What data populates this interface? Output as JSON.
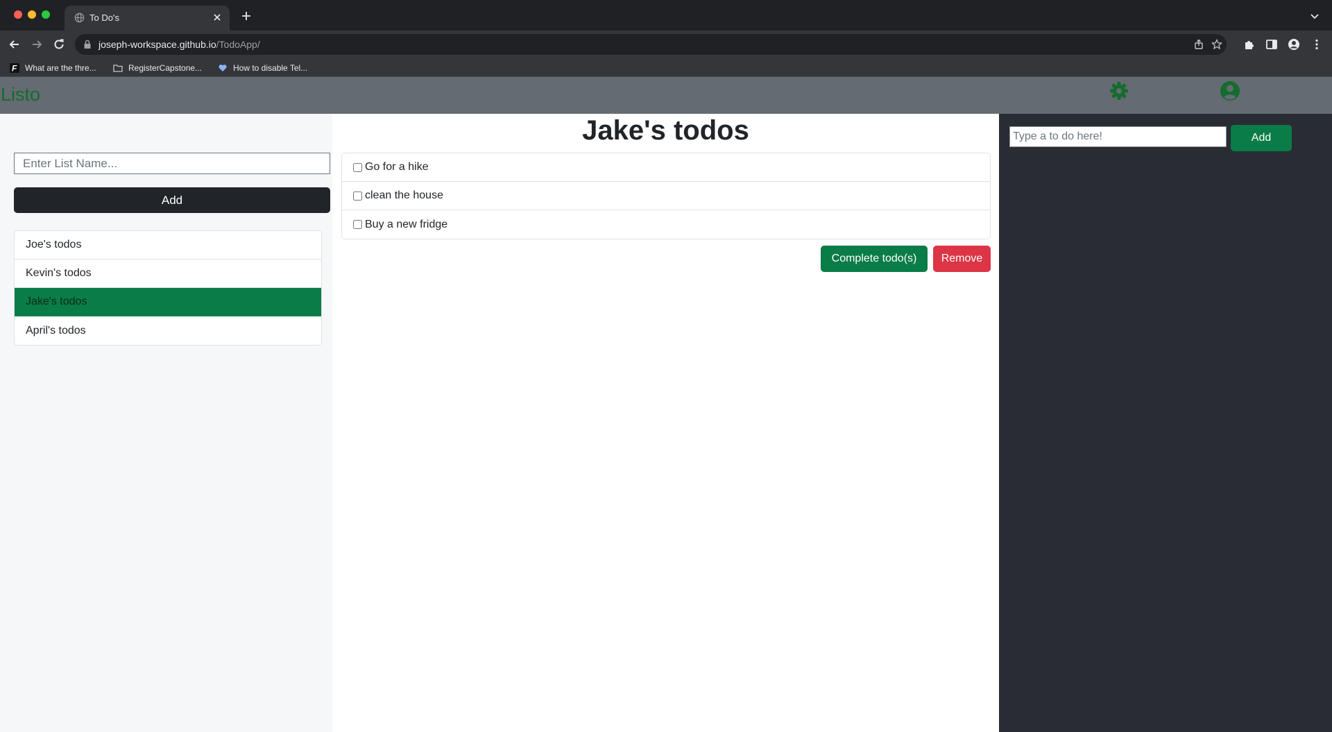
{
  "browser": {
    "tab_title": "To Do's",
    "url_host": "joseph-workspace.github.io",
    "url_path": "/TodoApp/",
    "bookmarks": [
      {
        "label": "What are the thre...",
        "icon": "f-icon"
      },
      {
        "label": "RegisterCapstone...",
        "icon": "folder-icon"
      },
      {
        "label": "How to disable Tel...",
        "icon": "heart-icon"
      }
    ]
  },
  "navbar": {
    "brand": "Listo",
    "brand_color": "#146c2e",
    "settings_icon": "gear-icon",
    "profile_icon": "user-circle-icon"
  },
  "lists_panel": {
    "input_placeholder": "Enter List Name...",
    "add_label": "Add",
    "lists": [
      {
        "label": "Joe's todos",
        "active": false
      },
      {
        "label": "Kevin's todos",
        "active": false
      },
      {
        "label": "Jake's todos",
        "active": true
      },
      {
        "label": "April's todos",
        "active": false
      }
    ]
  },
  "todos_panel": {
    "title": "Jake's todos",
    "todos": [
      {
        "label": "Go for a hike",
        "checked": false
      },
      {
        "label": "clean the house",
        "checked": false
      },
      {
        "label": "Buy a new fridge",
        "checked": false
      }
    ],
    "complete_label": "Complete todo(s)",
    "remove_label": "Remove"
  },
  "add_todo_panel": {
    "input_placeholder": "Type a to do here!",
    "add_label": "Add"
  },
  "colors": {
    "accent_green": "#0a7c47",
    "danger_red": "#dc3545",
    "navbar_gray": "#646b72",
    "sidebar_dark": "#292d33"
  }
}
